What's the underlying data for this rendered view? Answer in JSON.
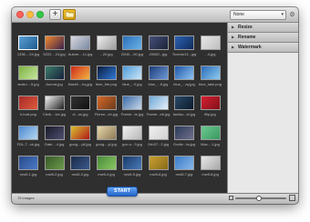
{
  "toolbar": {
    "add_label": "+",
    "preset_value": "None",
    "preset_caret": "▾",
    "gear_label": "⚙"
  },
  "actions": [
    {
      "label": "Resize"
    },
    {
      "label": "Rename"
    },
    {
      "label": "Watermark"
    }
  ],
  "status": {
    "text": "75 images"
  },
  "start_label": "START",
  "zoom_level": 0.45,
  "images": [
    {
      "name": "1336....24.jpg",
      "colors": [
        "#5aa0d8",
        "#1d5a8c"
      ]
    },
    {
      "name": "5222....24.jpg",
      "colors": [
        "#f28a2e",
        "#3a1f4b"
      ]
    },
    {
      "name": "Autum....1x.jpg",
      "colors": [
        "#d8d8e0",
        "#7a8aa2"
      ]
    },
    {
      "name": "...20.jpg",
      "colors": [
        "#f0f0f0",
        "#9c9c9c"
      ]
    },
    {
      "name": "2008....00.jpg",
      "colors": [
        "#2c6fb8",
        "#6bb3e8"
      ]
    },
    {
      "name": "20082...jpg",
      "colors": [
        "#47517a",
        "#1b2138"
      ]
    },
    {
      "name": "Tuxedo13...jpg",
      "colors": [
        "#2d63b4",
        "#0f2a5a"
      ]
    },
    {
      "name": "...4.jpg",
      "colors": [
        "#e7e7e7",
        "#bfbfbf"
      ]
    },
    {
      "name": "andro....5.jpg",
      "colors": [
        "#7cb342",
        "#c8e6a0"
      ]
    },
    {
      "name": "Aurora.jpg",
      "colors": [
        "#3e7e6a",
        "#151f3a"
      ]
    },
    {
      "name": "Backli....hq.jpg",
      "colors": [
        "#cc2a1c",
        "#f7b441"
      ]
    },
    {
      "name": "blue_fire.png",
      "colors": [
        "#0b1d3e",
        "#2f78d8"
      ]
    },
    {
      "name": "blue_...ll.jpg",
      "colors": [
        "#4c9bd8",
        "#cfe6f8"
      ]
    },
    {
      "name": "blue_...8.jpg",
      "colors": [
        "#1e3c78",
        "#6d9ad8"
      ]
    },
    {
      "name": "blue_...ay.jpg",
      "colors": [
        "#1e56a8",
        "#8fc4f0"
      ]
    },
    {
      "name": "blue_lake.png",
      "colors": [
        "#2a6bb8",
        "#8ecbf0"
      ]
    },
    {
      "name": "b.butt.png",
      "colors": [
        "#a52a2a",
        "#e05a3a"
      ]
    },
    {
      "name": "Clerk....ive.jpg",
      "colors": [
        "#f4f4f4",
        "#202020"
      ]
    },
    {
      "name": "cl...os.jpg",
      "colors": [
        "#333333",
        "#101010"
      ]
    },
    {
      "name": "Floren...ch.jpg",
      "colors": [
        "#d86a2a",
        "#6a3a1a"
      ]
    },
    {
      "name": "Frame...te.jpg",
      "colors": [
        "#3a6aa8",
        "#c8d8e8"
      ]
    },
    {
      "name": "Frame...eb.jpg",
      "colors": [
        "#6ea8d8",
        "#e8f0f8"
      ]
    },
    {
      "name": "landsc...ld.jpg",
      "colors": [
        "#2a4a6a",
        "#0a1a2a"
      ]
    },
    {
      "name": "filip.jpg",
      "colors": [
        "#d82030",
        "#80101a"
      ]
    },
    {
      "name": "FDL-T...ck.jpg",
      "colors": [
        "#4a88d0",
        "#b8d8f0"
      ]
    },
    {
      "name": "Gate....4.jpg",
      "colors": [
        "#1a1a2a",
        "#505070"
      ]
    },
    {
      "name": "goog....pil.jpg",
      "colors": [
        "#d8c030",
        "#b01818"
      ]
    },
    {
      "name": "goog....yl.jpg",
      "colors": [
        "#e8d8a8",
        "#8a7858"
      ]
    },
    {
      "name": "goo.o...3.jpg",
      "colors": [
        "#f0f0f0",
        "#b8b8b8"
      ]
    },
    {
      "name": "Orb37...2.jpg",
      "colors": [
        "#f0f0f0",
        "#d0d0d0"
      ]
    },
    {
      "name": "Godte...ta.jpg",
      "colors": [
        "#2a3a5a",
        "#70708a"
      ]
    },
    {
      "name": "Mac....1.jpg",
      "colors": [
        "#6ac890",
        "#3a9860"
      ]
    },
    {
      "name": "row5-1.jpg",
      "colors": [
        "#2a4a8a",
        "#4a7ac8"
      ]
    },
    {
      "name": "row5-2.jpg",
      "colors": [
        "#3a5a2a",
        "#6a9a4a"
      ]
    },
    {
      "name": "row5-3.jpg",
      "colors": [
        "#1a2a4a",
        "#3a5a8a"
      ]
    },
    {
      "name": "row5-4.jpg",
      "colors": [
        "#4a8a3a",
        "#8ac860"
      ]
    },
    {
      "name": "row5-5.jpg",
      "colors": [
        "#1a3a6a",
        "#4a7ab8"
      ]
    },
    {
      "name": "row5-6.jpg",
      "colors": [
        "#c8a030",
        "#8a6a18"
      ]
    },
    {
      "name": "row5-7.jpg",
      "colors": [
        "#3a7ac8",
        "#8ab8e8"
      ]
    },
    {
      "name": "row5-8.jpg",
      "colors": [
        "#e8e8e8",
        "#a8a8a8"
      ]
    }
  ]
}
